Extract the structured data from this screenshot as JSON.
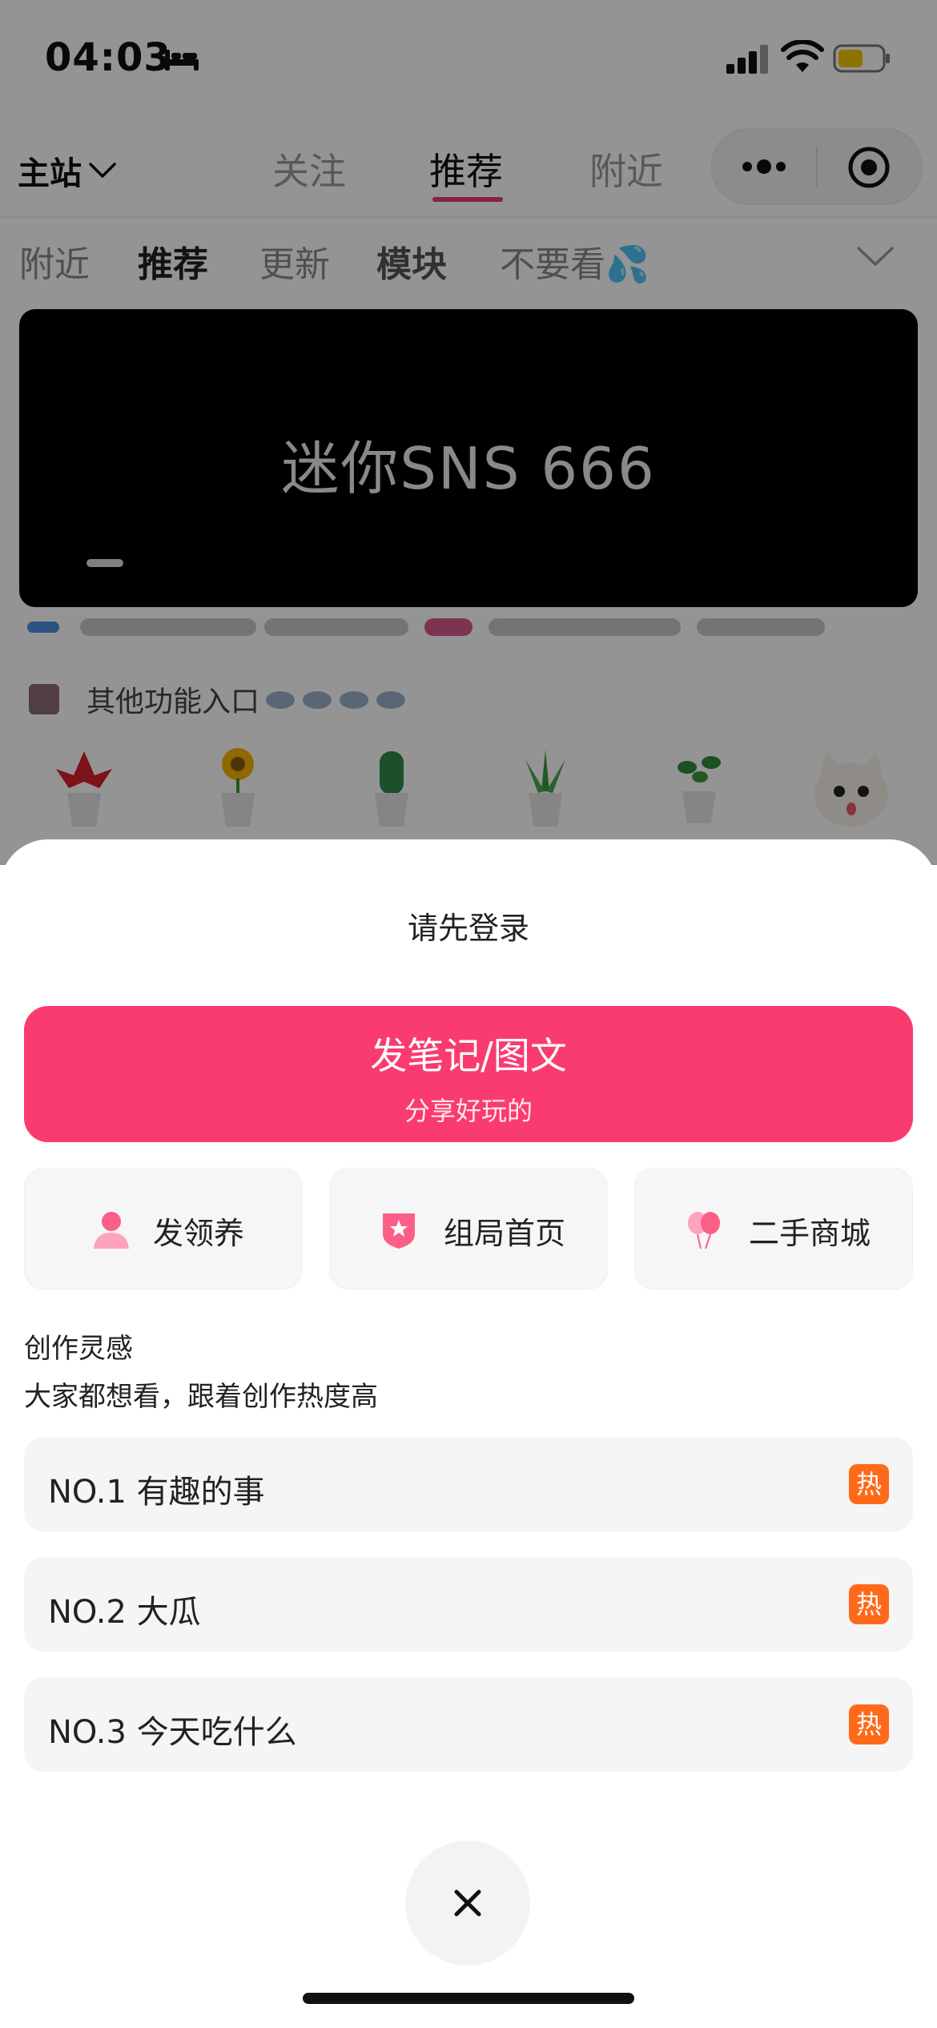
{
  "status_bar": {
    "time": "04:03"
  },
  "top_nav": {
    "site_select": "主站",
    "tabs": [
      {
        "label": "关注",
        "active": false
      },
      {
        "label": "推荐",
        "active": true
      },
      {
        "label": "附近",
        "active": false
      }
    ]
  },
  "sub_tabs": [
    {
      "label": "附近"
    },
    {
      "label": "推荐"
    },
    {
      "label": "更新"
    },
    {
      "label": "模块"
    },
    {
      "label": "不要看💦"
    }
  ],
  "banner": {
    "text": "迷你SNS 666"
  },
  "entry": {
    "label": "其他功能入口"
  },
  "sheet": {
    "title": "请先登录",
    "post_button": {
      "title": "发笔记/图文",
      "subtitle": "分享好玩的"
    },
    "quick_actions": [
      {
        "label": "发领养",
        "icon": "person-icon"
      },
      {
        "label": "组局首页",
        "icon": "star-shield-icon"
      },
      {
        "label": "二手商城",
        "icon": "balloons-icon"
      }
    ],
    "inspiration": {
      "title": "创作灵感",
      "subtitle": "大家都想看，跟着创作热度高"
    },
    "topics": [
      {
        "label": "NO.1 有趣的事",
        "badge": "热"
      },
      {
        "label": "NO.2 大瓜",
        "badge": "热"
      },
      {
        "label": "NO.3 今天吃什么",
        "badge": "热"
      }
    ]
  },
  "colors": {
    "accent_pink": "#fa3b6f",
    "tab_underline": "#e83e6e",
    "hot_badge": "#ff6a1a",
    "battery": "#f5c400"
  }
}
